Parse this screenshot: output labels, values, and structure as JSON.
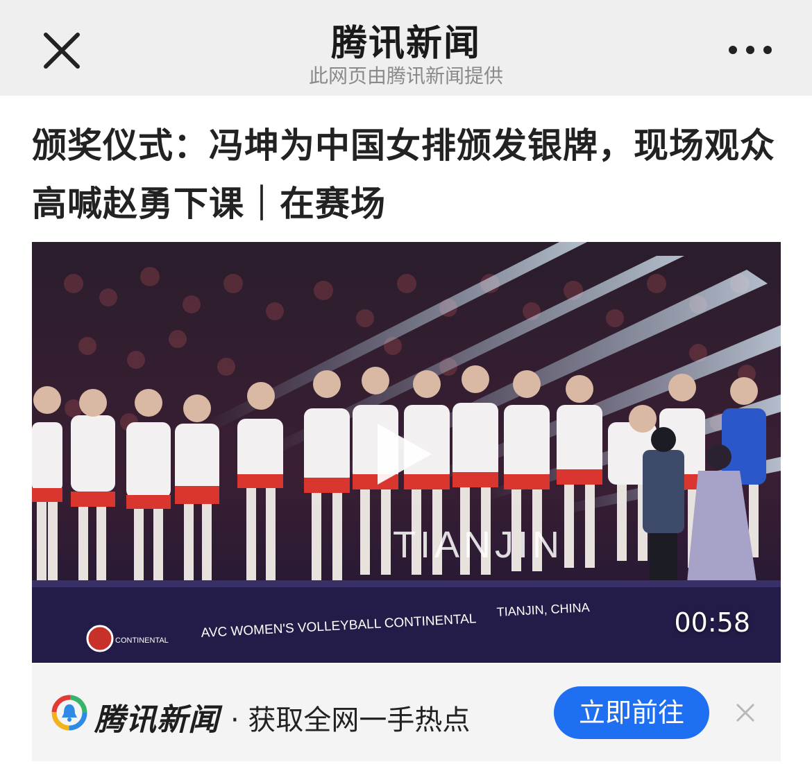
{
  "header": {
    "title": "腾讯新闻",
    "subtitle": "此网页由腾讯新闻提供",
    "close_icon": "close-icon",
    "more_icon": "more-dots-icon"
  },
  "article": {
    "headline": "颁奖仪式：冯坤为中国女排颁发银牌，现场观众高喊赵勇下课｜在赛场"
  },
  "video": {
    "duration": "00:58",
    "play_icon": "play-icon",
    "scene_texts": {
      "stage_banner": "AVC WOMEN'S VOLLEYBALL CONTINENTAL",
      "location": "TIANJIN, CHINA",
      "backdrop_city": "TIANJIN",
      "logo_text": "CONTINENTAL"
    }
  },
  "banner": {
    "brand": "腾讯新闻",
    "slogan": "· 获取全网一手热点",
    "button": "立即前往",
    "close_icon": "close-icon"
  },
  "colors": {
    "topbar_bg": "#efefef",
    "button_blue": "#1f6ff2",
    "banner_bg": "#f4f4f4"
  }
}
